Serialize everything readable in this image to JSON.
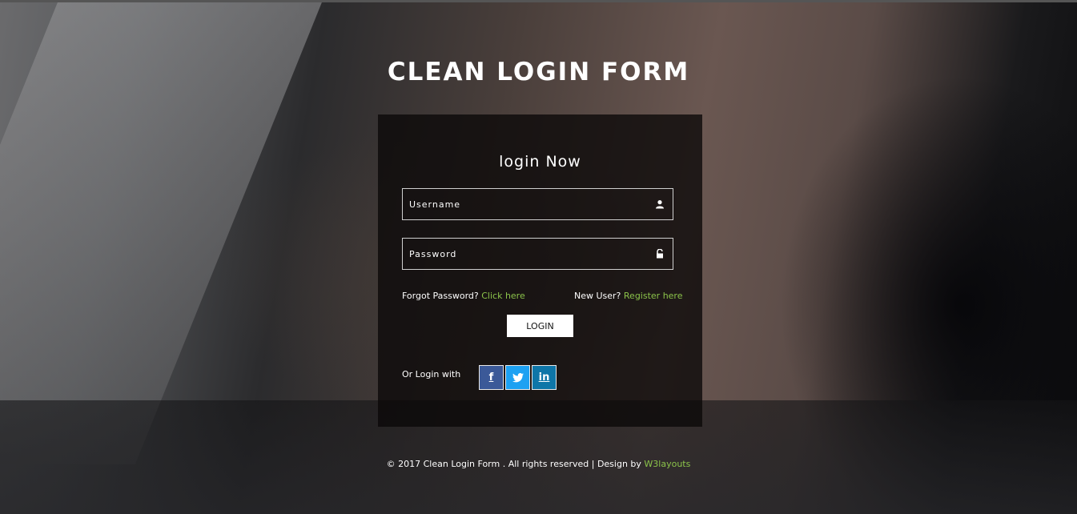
{
  "header": {
    "title": "CLEAN LOGIN FORM"
  },
  "form": {
    "heading": "login Now",
    "username_placeholder": "Username",
    "password_placeholder": "Password",
    "forgot_text": "Forgot Password?",
    "forgot_link": "Click here",
    "new_user_text": "New User?",
    "register_link": "Register here",
    "login_label": "LOGIN",
    "or_login_text": "Or Login with",
    "social": [
      {
        "label": "f",
        "icon": "facebook-icon",
        "color": "#3b5998"
      },
      {
        "label": "t",
        "icon": "twitter-icon",
        "color": "#1da1f2"
      },
      {
        "label": "in",
        "icon": "linkedin-icon",
        "color": "#0e76a8"
      }
    ]
  },
  "footer": {
    "text": "© 2017 Clean Login Form . All rights reserved | Design by",
    "link": "W3layouts",
    "link_color": "#8bc34a"
  }
}
